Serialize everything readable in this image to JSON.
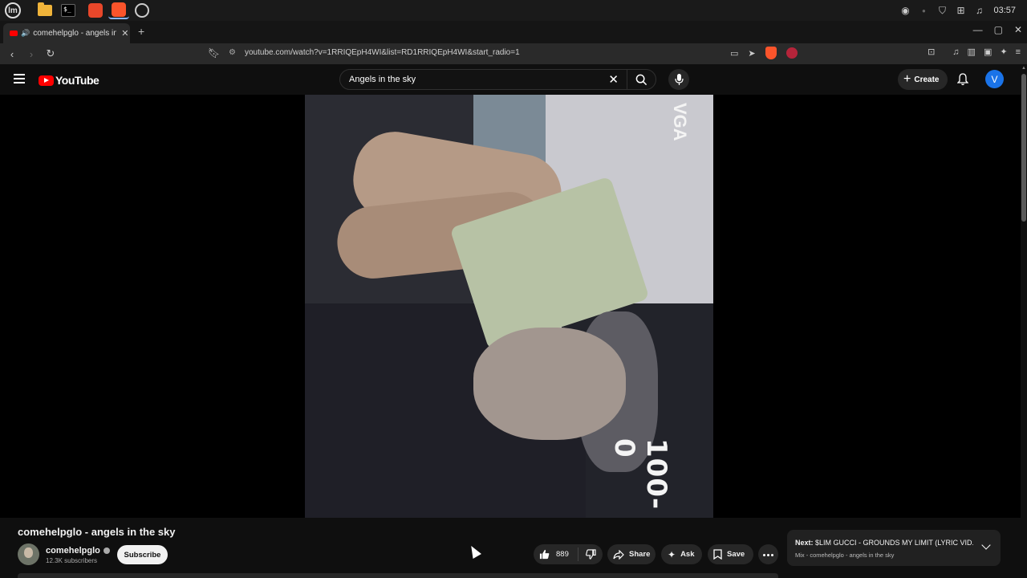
{
  "taskbar": {
    "apps": [
      "mint-menu",
      "files",
      "terminal",
      "brave-browser",
      "chromium"
    ],
    "clock": "03:57"
  },
  "browser": {
    "tab": {
      "title": "comehelpglo - angels in the sky"
    },
    "url": "youtube.com/watch?v=1RRIQEpH4WI&list=RD1RRIQEpH4WI&start_radio=1"
  },
  "youtube": {
    "logo_text": "YouTube",
    "search": {
      "value": "Angels in the sky"
    },
    "create_label": "Create",
    "avatar_letter": "V"
  },
  "video": {
    "title": "comehelpglo - angels in the sky",
    "overlay_bottom": "100-0",
    "overlay_top": "VGA"
  },
  "channel": {
    "name": "comehelpglo",
    "subscribers": "12.3K subscribers",
    "subscribe_label": "Subscribe"
  },
  "actions": {
    "like_count": "889",
    "share_label": "Share",
    "ask_label": "Ask",
    "save_label": "Save"
  },
  "next_up": {
    "prefix": "Next:",
    "title": "$LIM GUCCI - GROUNDS MY LIMIT (LYRIC VID...",
    "subtitle": "Mix - comehelpglo - angels in the sky"
  },
  "colors": {
    "brand_red": "#ff0000",
    "avatar_blue": "#1a73e8",
    "background": "#0f0f0f"
  }
}
